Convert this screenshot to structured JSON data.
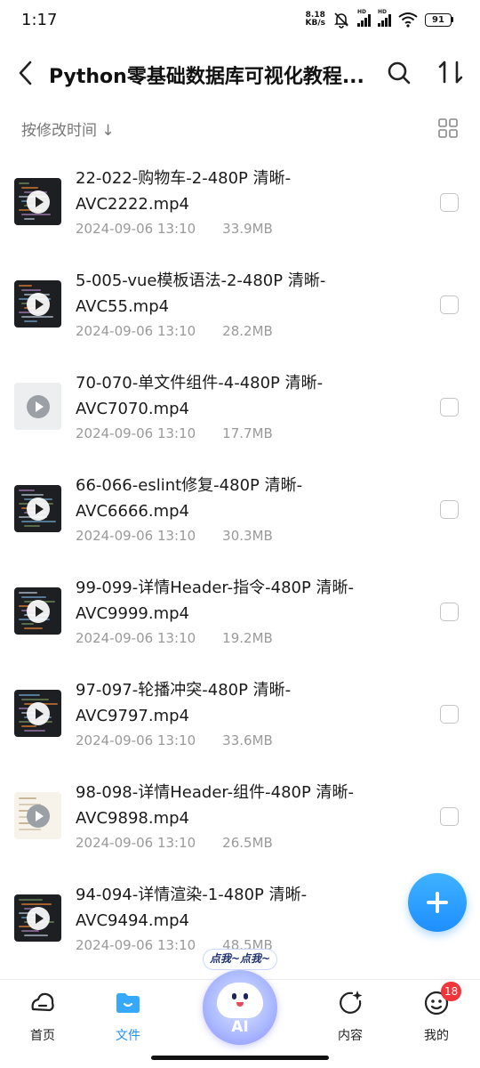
{
  "status_bar": {
    "time": "1:17",
    "net_speed_value": "8.18",
    "net_speed_unit": "KB/s",
    "signal_label": "HD",
    "battery": "91"
  },
  "header": {
    "title": "Python零基础数据库可视化教程...",
    "back_icon": "back-arrow-icon",
    "search_icon": "search-icon",
    "sort_icon": "sort-icon"
  },
  "sort_row": {
    "label": "按修改时间 ↓",
    "view_icon": "grid-view-icon"
  },
  "files": [
    {
      "name": "22-022-购物车-2-480P 清晰-AVC2222.mp4",
      "date": "2024-09-06 13:10",
      "size": "33.9MB",
      "thumb": "dark"
    },
    {
      "name": "5-005-vue模板语法-2-480P 清晰-AVC55.mp4",
      "date": "2024-09-06 13:10",
      "size": "28.2MB",
      "thumb": "dark"
    },
    {
      "name": "70-070-单文件组件-4-480P 清晰-AVC7070.mp4",
      "date": "2024-09-06 13:10",
      "size": "17.7MB",
      "thumb": "light"
    },
    {
      "name": "66-066-eslint修复-480P 清晰-AVC6666.mp4",
      "date": "2024-09-06 13:10",
      "size": "30.3MB",
      "thumb": "dark"
    },
    {
      "name": "99-099-详情Header-指令-480P 清晰-AVC9999.mp4",
      "date": "2024-09-06 13:10",
      "size": "19.2MB",
      "thumb": "dark"
    },
    {
      "name": "97-097-轮播冲突-480P 清晰-AVC9797.mp4",
      "date": "2024-09-06 13:10",
      "size": "33.6MB",
      "thumb": "dark"
    },
    {
      "name": "98-098-详情Header-组件-480P 清晰-AVC9898.mp4",
      "date": "2024-09-06 13:10",
      "size": "26.5MB",
      "thumb": "doc"
    },
    {
      "name": "94-094-详情渲染-1-480P 清晰-AVC9494.mp4",
      "date": "2024-09-06 13:10",
      "size": "48.5MB",
      "thumb": "dark"
    }
  ],
  "fab": {
    "icon": "plus-icon"
  },
  "ai": {
    "bubble": "点我~点我~",
    "label": "AI"
  },
  "nav": {
    "items": [
      {
        "label": "首页",
        "icon": "home-icon",
        "active": false
      },
      {
        "label": "文件",
        "icon": "folder-icon",
        "active": true
      },
      {
        "label": "内容",
        "icon": "discover-icon",
        "active": false
      },
      {
        "label": "我的",
        "icon": "profile-icon",
        "active": false,
        "badge": "18"
      }
    ]
  },
  "colors": {
    "accent": "#1d8ff0",
    "badge": "#f0353b",
    "meta_text": "#9a9a9a"
  }
}
